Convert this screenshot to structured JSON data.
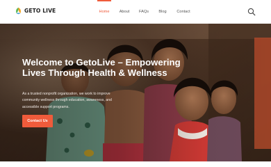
{
  "brand": {
    "name": "GETO LIVE",
    "icon": "leaf-logo-icon",
    "colors": {
      "accent": "#ef5b3b",
      "logo_green": "#5cb85c",
      "logo_orange": "#f5a623"
    }
  },
  "nav": {
    "items": [
      {
        "label": "Home",
        "active": true
      },
      {
        "label": "About",
        "active": false
      },
      {
        "label": "FAQs",
        "active": false
      },
      {
        "label": "Blog",
        "active": false
      },
      {
        "label": "Contact",
        "active": false
      }
    ],
    "search_icon": "search-icon"
  },
  "hero": {
    "title": "Welcome to GetoLive – Empowering Lives Through Health & Wellness",
    "description": "As a trusted nonprofit organization, we work to improve community wellness through education, awareness, and accessible support programs.",
    "cta_label": "Contact Us",
    "background": "photo of smiling children"
  }
}
